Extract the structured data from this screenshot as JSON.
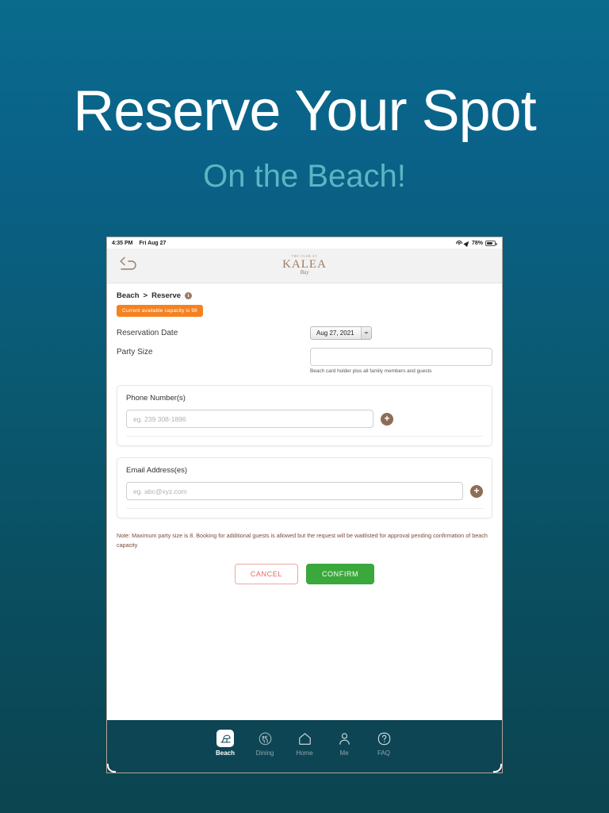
{
  "hero": {
    "title": "Reserve Your Spot",
    "subtitle": "On the Beach!"
  },
  "colors": {
    "background_top": "#0a6b8d",
    "background_bottom": "#0c4450",
    "subtitle": "#5cb5c4",
    "brand_brown": "#9e7b66",
    "capacity_orange": "#f58220",
    "confirm_green": "#3aa83a",
    "cancel_red": "#e8695f",
    "nav_bar": "#0d4554"
  },
  "status_bar": {
    "time": "4:35 PM",
    "date": "Fri Aug 27",
    "wifi_icon": "wifi-icon",
    "location_icon": "location-arrow-icon",
    "battery_percent": "78%",
    "battery_icon": "battery-icon"
  },
  "app_header": {
    "back_icon": "back-arrow-icon",
    "logo_line1": "THE CLUB AT",
    "logo_line2": "KALEA",
    "logo_line3": "Bay"
  },
  "breadcrumb": {
    "parent": "Beach",
    "separator": ">",
    "current": "Reserve",
    "info_icon": "info-icon",
    "info_glyph": "i"
  },
  "capacity_badge": {
    "text": "Current available capacity is 98"
  },
  "form": {
    "reservation_date": {
      "label": "Reservation Date",
      "value": "Aug 27, 2021",
      "chevron_icon": "chevron-down-icon"
    },
    "party_size": {
      "label": "Party Size",
      "value": "",
      "placeholder": "",
      "helper": "Beach card holder plus all family members and guests"
    },
    "phone": {
      "title": "Phone Number(s)",
      "placeholder": "eg. 239 308-1896",
      "value": "",
      "add_icon": "plus-icon",
      "add_glyph": "+"
    },
    "email": {
      "title": "Email Address(es)",
      "placeholder": "eg. abc@xyz.com",
      "value": "",
      "add_icon": "plus-icon",
      "add_glyph": "+"
    },
    "note": "Note: Maximum party size is 8. Booking for additional guests is allowed but the request will be waitlisted for approval pending confirmation of beach capacity",
    "cancel_label": "CANCEL",
    "confirm_label": "CONFIRM"
  },
  "bottom_nav": {
    "items": [
      {
        "label": "Beach",
        "icon": "beach-chair-icon",
        "active": true
      },
      {
        "label": "Dining",
        "icon": "dining-emblem-icon",
        "active": false
      },
      {
        "label": "Home",
        "icon": "home-icon",
        "active": false
      },
      {
        "label": "Me",
        "icon": "person-icon",
        "active": false
      },
      {
        "label": "FAQ",
        "icon": "question-circle-icon",
        "active": false
      }
    ]
  }
}
